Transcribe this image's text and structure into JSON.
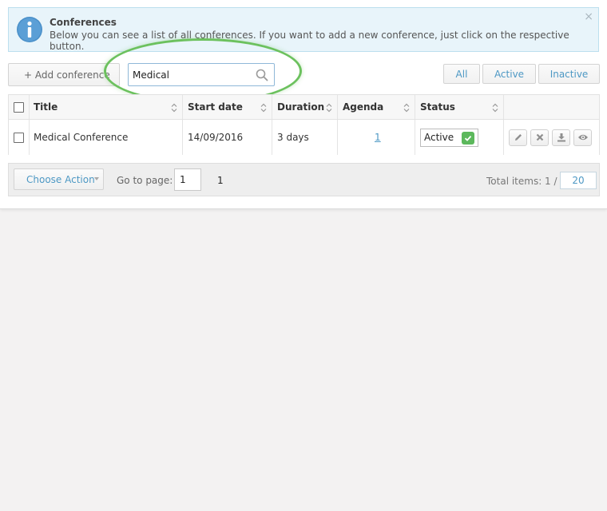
{
  "info": {
    "title": "Conferences",
    "text": "Below you can see a list of all conferences. If you want to add a new conference, just click on the respective button.",
    "close": "×"
  },
  "toolbar": {
    "add_label": "+ Add conference",
    "search_value": "Medical",
    "filters": {
      "all": "All",
      "active": "Active",
      "inactive": "Inactive"
    }
  },
  "table": {
    "headers": {
      "title": "Title",
      "start_date": "Start date",
      "duration": "Duration",
      "agenda": "Agenda",
      "status": "Status"
    },
    "rows": [
      {
        "title": "Medical Conference",
        "start_date": "14/09/2016",
        "duration": "3 days",
        "agenda": "1",
        "status": "Active"
      }
    ]
  },
  "pagination": {
    "choose_action": "Choose Action",
    "goto_label": "Go to page:",
    "goto_value": "1",
    "pages": "1",
    "total_label": "Total items: 1 /",
    "per_page": "20"
  },
  "colors": {
    "accent": "#4d98c4",
    "highlight": "#6cc15e",
    "status_ok": "#5cb85c",
    "info_bg": "#e8f4fa"
  },
  "icons": [
    "info-icon",
    "close-icon",
    "search-icon",
    "sort-icon",
    "check-icon",
    "edit-icon",
    "delete-icon",
    "download-icon",
    "view-icon"
  ]
}
